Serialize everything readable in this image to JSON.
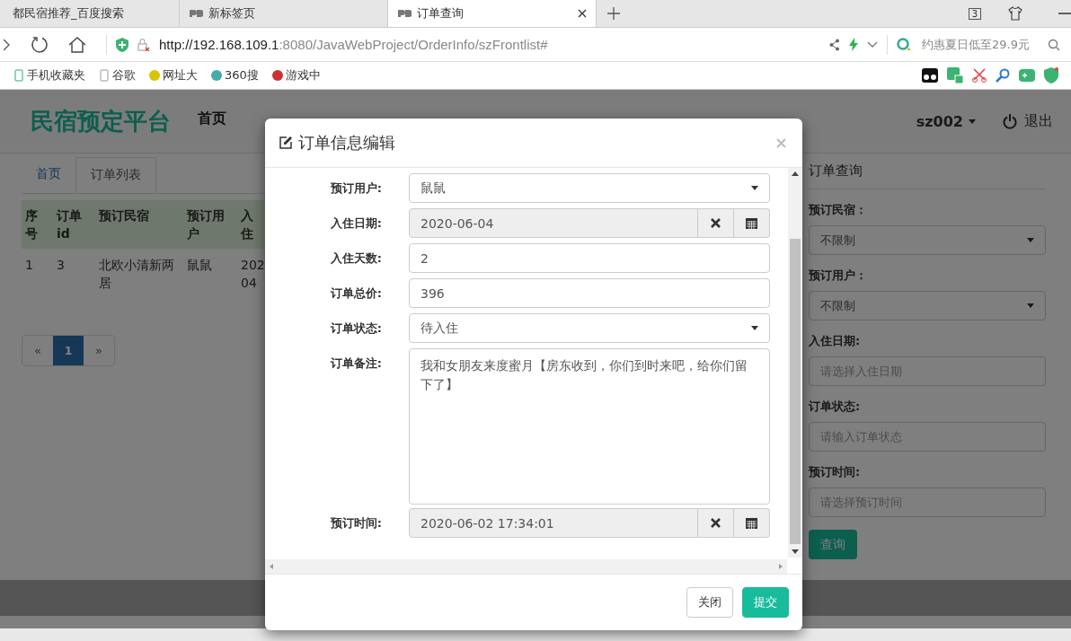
{
  "browser": {
    "tabs": [
      {
        "title": "都民宿推荐_百度搜索",
        "selected": false
      },
      {
        "title": "新标签页",
        "selected": false
      },
      {
        "title": "订单查询",
        "selected": true
      }
    ],
    "tab_count": "3",
    "url": {
      "host": "http://192.168.109.1",
      "path": ":8080/JavaWebProject/OrderInfo/szFrontlist#"
    },
    "search_hint": "约惠夏日低至29.9元",
    "bookmarks": [
      "手机收藏夹",
      "谷歌",
      "网址大",
      "360搜",
      "游戏中"
    ]
  },
  "header": {
    "logo": "民宿预定平台",
    "nav": [
      "首页"
    ],
    "user": "sz002",
    "logout": "退出"
  },
  "page_tabs": [
    {
      "label": "首页",
      "selected": false
    },
    {
      "label": "订单列表",
      "selected": true
    }
  ],
  "table": {
    "columns": [
      "序号",
      "订单id",
      "预订民宿",
      "预订用户",
      "入住"
    ],
    "rows": [
      [
        "1",
        "3",
        "北欧小清新两居",
        "鼠鼠",
        "202 04"
      ]
    ]
  },
  "pagination": [
    {
      "label": "«",
      "selected": false
    },
    {
      "label": "1",
      "selected": true
    },
    {
      "label": "»",
      "selected": false
    }
  ],
  "search_panel": {
    "title": "订单查询",
    "fields": [
      {
        "label": "预订民宿：",
        "kind": "select",
        "value": "不限制"
      },
      {
        "label": "预订用户：",
        "kind": "select",
        "value": "不限制"
      },
      {
        "label": "入住日期:",
        "kind": "input",
        "placeholder": "请选择入住日期"
      },
      {
        "label": "订单状态:",
        "kind": "input",
        "placeholder": "请输入订单状态"
      },
      {
        "label": "预订时间:",
        "kind": "input",
        "placeholder": "请选择预订时间"
      }
    ],
    "button": "查询"
  },
  "modal": {
    "title": "订单信息编辑",
    "fields": [
      {
        "label": "预订用户:",
        "kind": "select",
        "value": "鼠鼠"
      },
      {
        "label": "入住日期:",
        "kind": "date",
        "value": "2020-06-04"
      },
      {
        "label": "入住天数:",
        "kind": "input",
        "value": "2"
      },
      {
        "label": "订单总价:",
        "kind": "input",
        "value": "396"
      },
      {
        "label": "订单状态:",
        "kind": "select",
        "value": "待入住"
      },
      {
        "label": "订单备注:",
        "kind": "textarea",
        "value": "我和女朋友来度蜜月【房东收到，你们到时来吧，给你们留下了】"
      },
      {
        "label": "预订时间:",
        "kind": "date",
        "value": "2020-06-02 17:34:01"
      }
    ],
    "buttons": [
      {
        "label": "关闭",
        "kind": "default"
      },
      {
        "label": "提交",
        "kind": "primary"
      }
    ]
  }
}
